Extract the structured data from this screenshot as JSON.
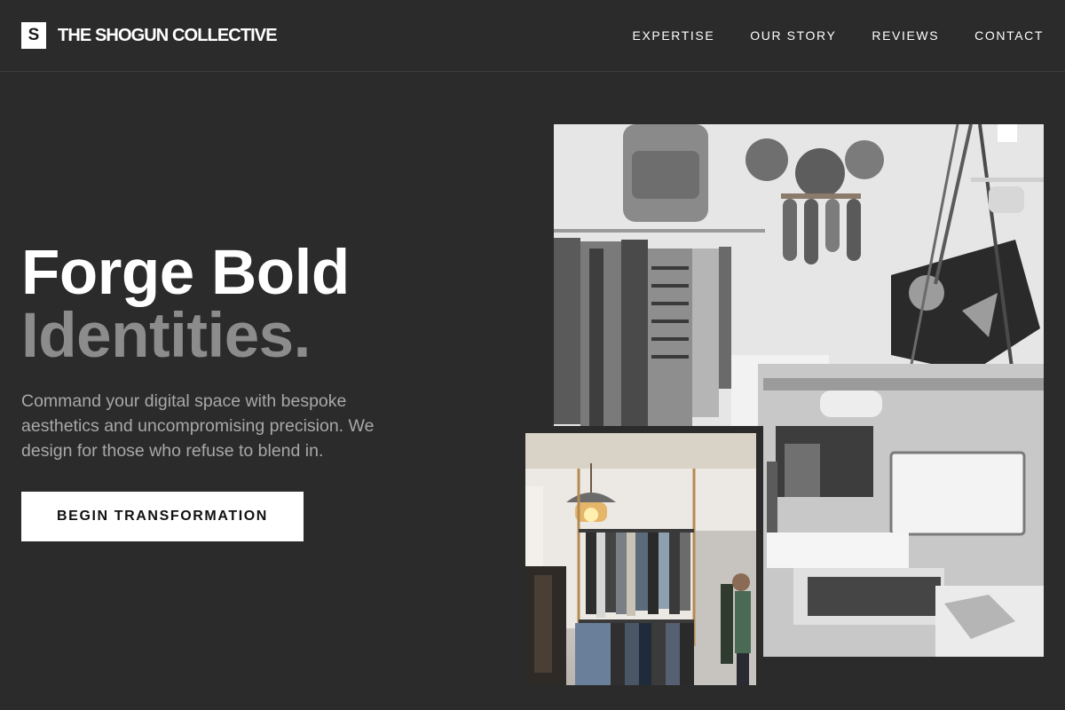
{
  "header": {
    "logo_letter": "S",
    "brand_name": "THE SHOGUN COLLECTIVE",
    "nav": [
      {
        "label": "EXPERTISE"
      },
      {
        "label": "OUR STORY"
      },
      {
        "label": "REVIEWS"
      },
      {
        "label": "CONTACT"
      }
    ]
  },
  "hero": {
    "title_line1": "Forge Bold",
    "title_line2": "Identities.",
    "subtitle": "Command your digital space with bespoke aesthetics and uncompromising precision. We design for those who refuse to blend in.",
    "cta_label": "BEGIN TRANSFORMATION"
  },
  "colors": {
    "background": "#2b2b2b",
    "accent_light": "#ffffff",
    "muted_title": "#8c8c8c",
    "body_text": "#a8a8a8"
  }
}
